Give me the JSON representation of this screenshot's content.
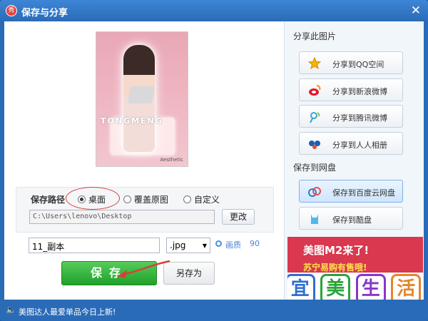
{
  "window": {
    "title": "保存与分享",
    "logo_text": "秀",
    "close_label": "✕"
  },
  "preview": {
    "brand_text": "TONGMENG",
    "watermark": "Aesthetic"
  },
  "save": {
    "path_label": "保存路径",
    "options": [
      {
        "label": "桌面",
        "selected": true
      },
      {
        "label": "覆盖原图",
        "selected": false
      },
      {
        "label": "自定义",
        "selected": false
      }
    ],
    "path_value": "C:\\Users\\lenovo\\Desktop",
    "change_label": "更改",
    "filename": "11_副本",
    "extension": ".jpg",
    "quality_label": "画质",
    "quality_value": "90",
    "save_label": "保存",
    "save_as_label": "另存为"
  },
  "share": {
    "title": "分享此图片",
    "items": [
      {
        "label": "分享到QQ空间",
        "icon": "star-icon"
      },
      {
        "label": "分享到新浪微博",
        "icon": "weibo-icon"
      },
      {
        "label": "分享到腾讯微博",
        "icon": "tencent-weibo-icon"
      },
      {
        "label": "分享到人人相册",
        "icon": "renren-icon"
      }
    ]
  },
  "cloud": {
    "title": "保存到网盘",
    "items": [
      {
        "label": "保存到百度云网盘",
        "icon": "baidu-cloud-icon",
        "active": true
      },
      {
        "label": "保存到酷盘",
        "icon": "kupan-icon",
        "active": false
      }
    ]
  },
  "ad": {
    "line1": "美图M2来了!",
    "line2": "苏宁易购有售哦!"
  },
  "overlay": [
    "宜",
    "美",
    "生",
    "活"
  ],
  "status": {
    "text": "美图达人最爱单品今日上新!",
    "speaker_icon": "speaker-icon"
  },
  "colors": {
    "accent": "#2a6bb8",
    "save_green": "#1ea12a",
    "annotation_red": "#d6403b"
  }
}
